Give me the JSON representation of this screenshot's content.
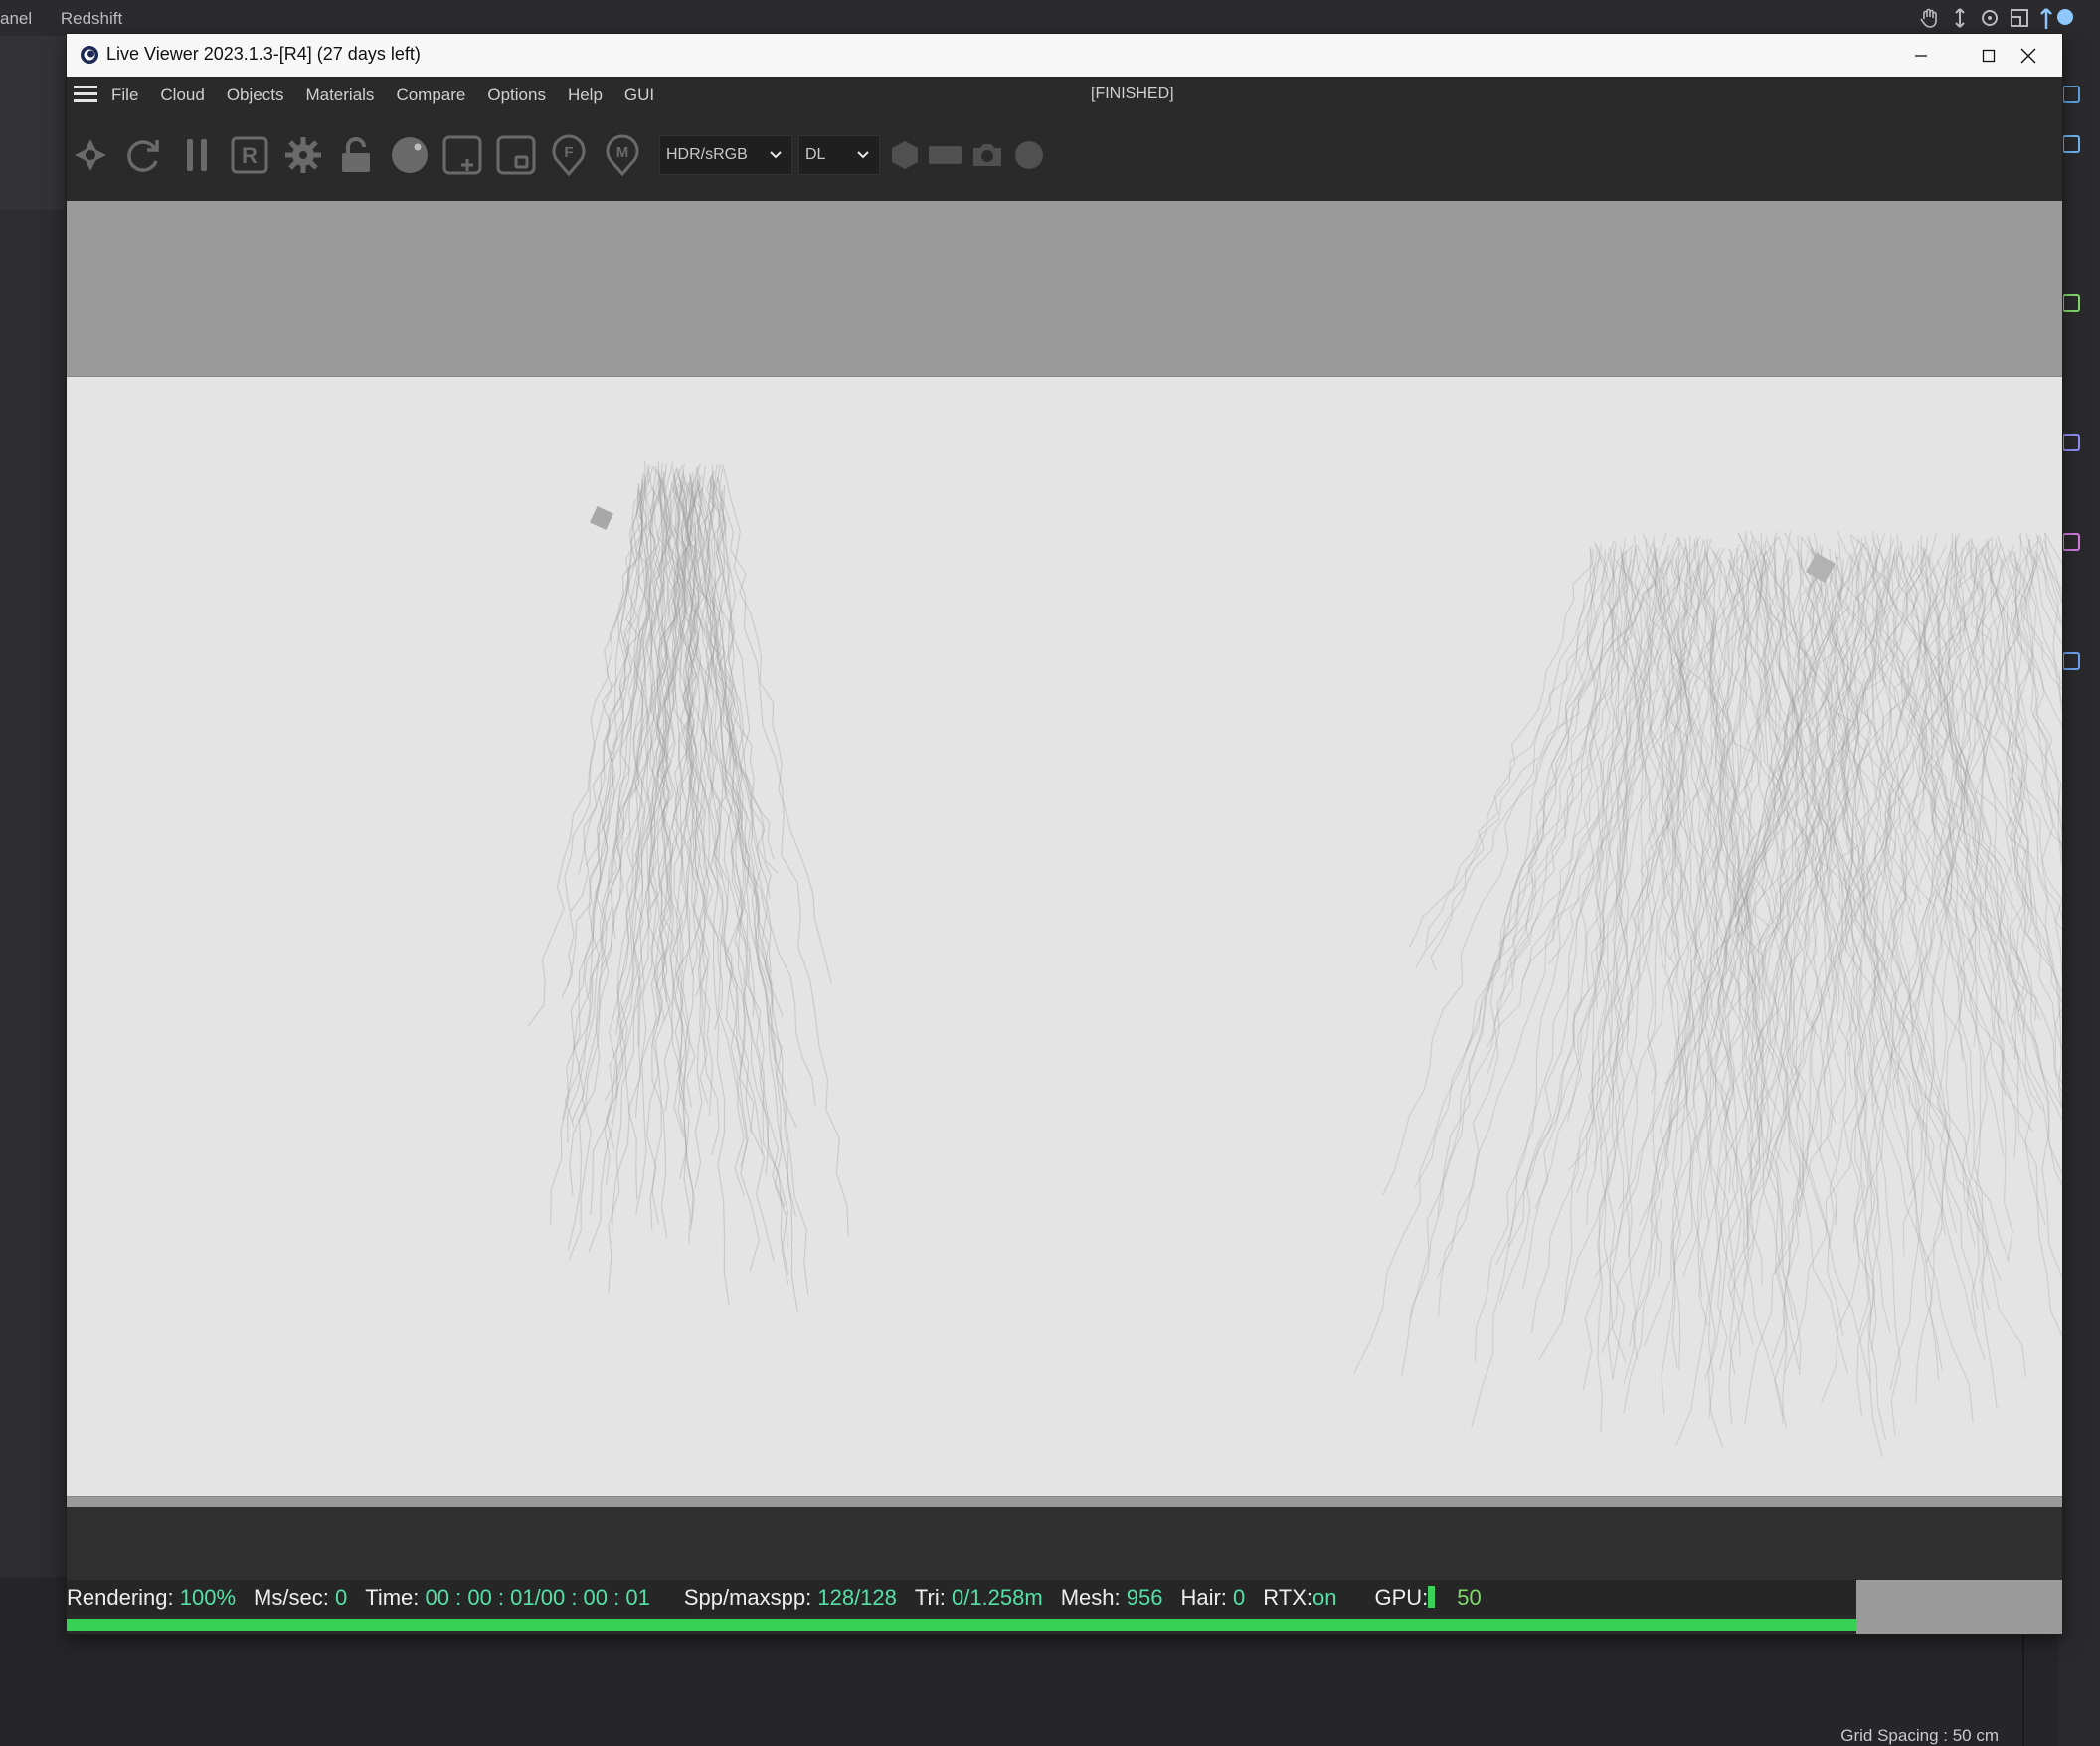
{
  "host": {
    "menu": [
      "anel",
      "Redshift"
    ],
    "grid_spacing": "Grid Spacing : 50 cm",
    "icons": [
      "hand-icon",
      "move-icon",
      "rotate-icon",
      "frame-icon",
      "view-icon"
    ]
  },
  "window": {
    "title": "Live Viewer 2023.1.3-[R4] (27 days left)",
    "controls": [
      "minimize",
      "maximize",
      "close"
    ]
  },
  "menubar": {
    "items": [
      "File",
      "Cloud",
      "Objects",
      "Materials",
      "Compare",
      "Options",
      "Help",
      "GUI"
    ],
    "status": "[FINISHED]"
  },
  "toolbar": {
    "icons": [
      "aperture-icon",
      "refresh-icon",
      "pause-icon",
      "render-r-icon",
      "gear-icon",
      "unlock-icon",
      "sphere-icon",
      "add-region-icon",
      "region-icon",
      "focus-pin-icon",
      "material-pin-icon",
      "hexagon-icon",
      "rectangle-icon",
      "camera-icon",
      "circle-icon"
    ],
    "tonemap_select": "HDR/sRGB",
    "kernel_select": "DL"
  },
  "statusbar": {
    "rendering_label": "Rendering:",
    "rendering_value": "100%",
    "ms_label": "Ms/sec:",
    "ms_value": "0",
    "time_label": "Time:",
    "time_value": "00 : 00 : 01/00 : 00 : 01",
    "spp_label": "Spp/maxspp:",
    "spp_value": "128/128",
    "tri_label": "Tri:",
    "tri_value": "0/1.258m",
    "mesh_label": "Mesh:",
    "mesh_value": "956",
    "hair_label": "Hair:",
    "hair_value": "0",
    "rtx_label": "RTX:",
    "rtx_value": "on",
    "gpu_label": "GPU:",
    "gpu_value": "50",
    "progress": 1.0
  },
  "colors": {
    "accent_green": "#37d155",
    "value_teal": "#54e1a6",
    "render_bg": "#e4e4e4",
    "viewport_bg": "#9a9a9a"
  }
}
